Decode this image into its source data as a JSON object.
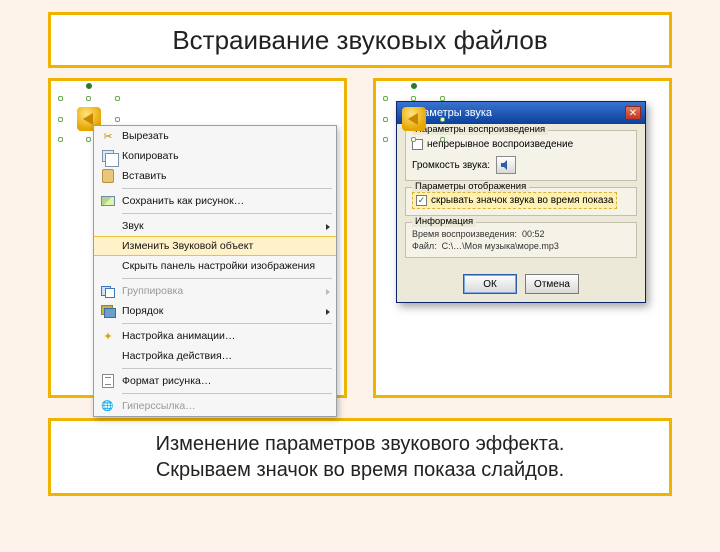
{
  "title": "Встраивание звуковых файлов",
  "caption": {
    "line1": "Изменение параметров звукового эффекта.",
    "line2": "Скрываем значок во время показа слайдов."
  },
  "context_menu": [
    {
      "icon": "scissors-icon",
      "label": "Вырезать",
      "type": "item"
    },
    {
      "icon": "copy-icon",
      "label": "Копировать",
      "type": "item"
    },
    {
      "icon": "paste-icon",
      "label": "Вставить",
      "type": "item"
    },
    {
      "type": "sep"
    },
    {
      "icon": "picture-icon",
      "label": "Сохранить как рисунок…",
      "type": "item"
    },
    {
      "type": "sep"
    },
    {
      "icon": "",
      "label": "Звук",
      "type": "sub"
    },
    {
      "icon": "",
      "label": "Изменить Звуковой объект",
      "type": "item",
      "selected": true
    },
    {
      "icon": "",
      "label": "Скрыть панель настройки изображения",
      "type": "item"
    },
    {
      "type": "sep"
    },
    {
      "icon": "group-icon",
      "label": "Группировка",
      "type": "sub",
      "disabled": true
    },
    {
      "icon": "order-icon",
      "label": "Порядок",
      "type": "sub"
    },
    {
      "type": "sep"
    },
    {
      "icon": "star-icon",
      "label": "Настройка анимации…",
      "type": "item"
    },
    {
      "icon": "",
      "label": "Настройка действия…",
      "type": "item"
    },
    {
      "type": "sep"
    },
    {
      "icon": "format-icon",
      "label": "Формат рисунка…",
      "type": "item"
    },
    {
      "type": "sep"
    },
    {
      "icon": "link-icon",
      "label": "Гиперссылка…",
      "type": "item",
      "disabled": true
    }
  ],
  "dialog": {
    "title": "Параметры звука",
    "group_play": "Параметры воспроизведения",
    "chk_loop": "непрерывное воспроизведение",
    "volume_label": "Громкость звука:",
    "group_display": "Параметры отображения",
    "chk_hide": "скрывать значок звука во время показа",
    "group_info": "Информация",
    "info_time_label": "Время воспроизведения:",
    "info_time_value": "00:52",
    "info_file_label": "Файл:",
    "info_file_value": "C:\\…\\Моя музыка\\море.mp3",
    "btn_ok": "ОК",
    "btn_cancel": "Отмена"
  }
}
